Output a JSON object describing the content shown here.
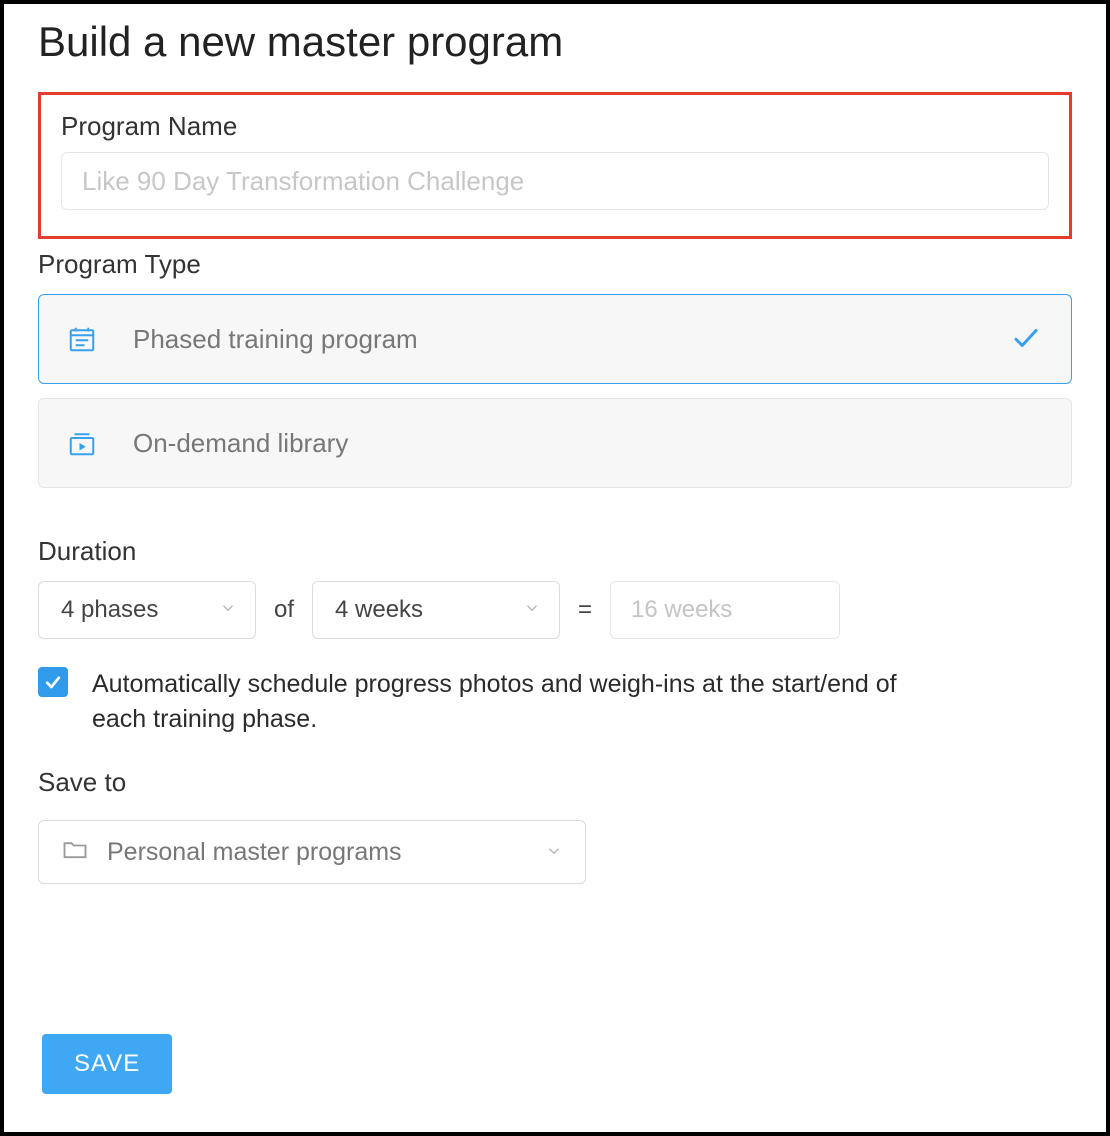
{
  "title": "Build a new master program",
  "programName": {
    "label": "Program Name",
    "placeholder": "Like 90 Day Transformation Challenge",
    "value": ""
  },
  "programType": {
    "label": "Program Type",
    "options": [
      {
        "icon": "calendar-list-icon",
        "label": "Phased training program",
        "selected": true
      },
      {
        "icon": "video-library-icon",
        "label": "On-demand library",
        "selected": false
      }
    ]
  },
  "duration": {
    "label": "Duration",
    "phases": "4 phases",
    "of": "of",
    "weeks": "4 weeks",
    "equals": "=",
    "total_placeholder": "16 weeks",
    "total_value": ""
  },
  "autoSchedule": {
    "checked": true,
    "label": "Automatically schedule progress photos and weigh-ins at the start/end of each training phase."
  },
  "saveTo": {
    "label": "Save to",
    "value": "Personal master programs"
  },
  "buttons": {
    "save": "SAVE"
  }
}
